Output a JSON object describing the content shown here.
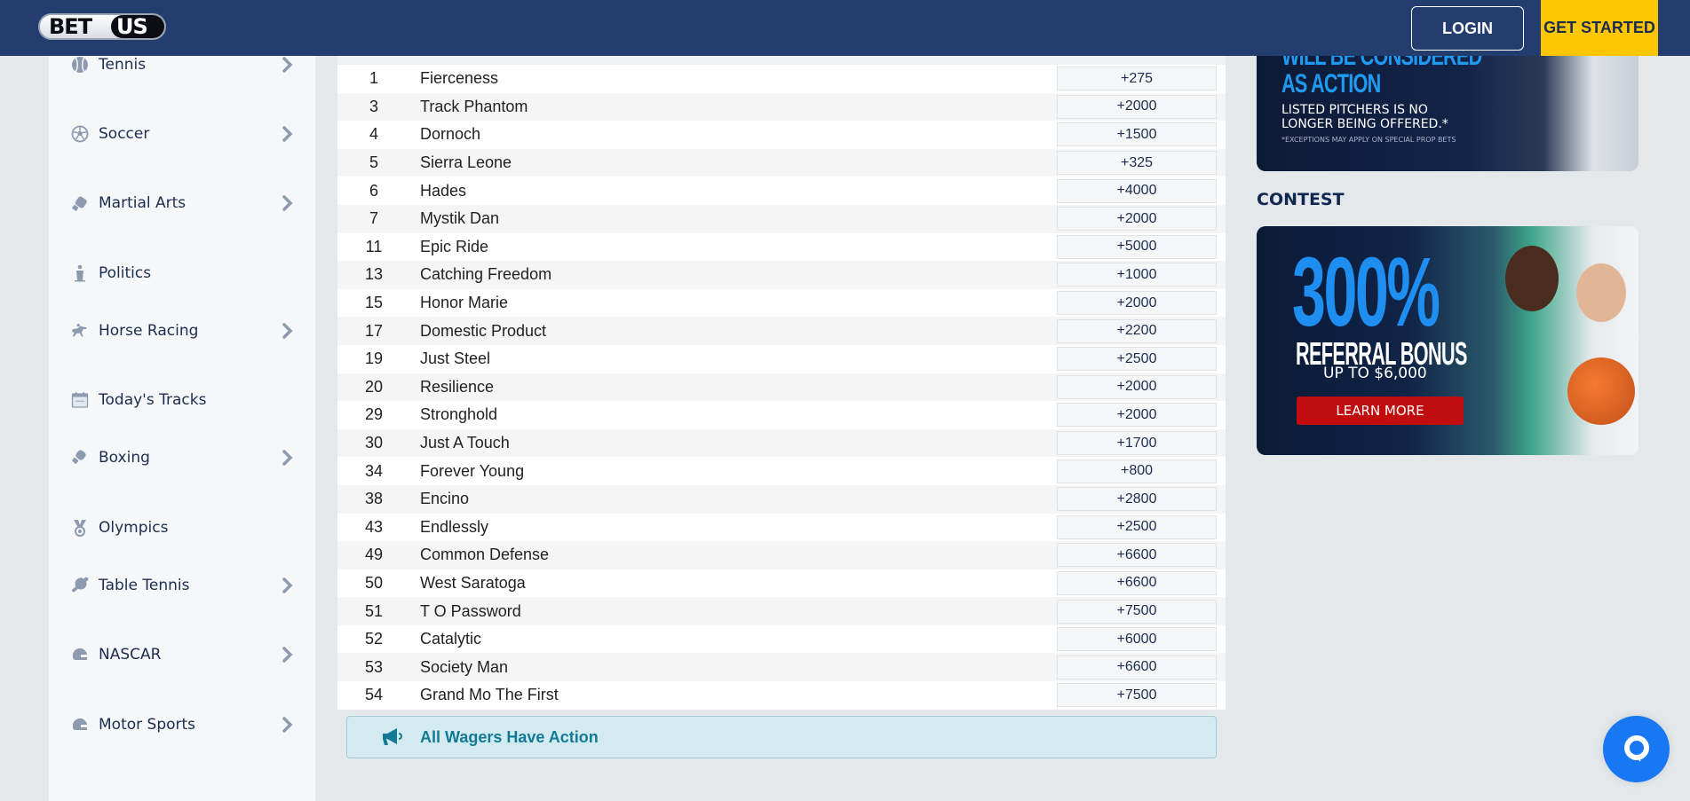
{
  "header": {
    "logo_left": "BET",
    "logo_right": "US",
    "login_label": "LOGIN",
    "get_started_label": "GET STARTED"
  },
  "sidebar": {
    "items": [
      {
        "label": "Tennis",
        "icon": "tennis-ball-icon",
        "has_chevron": true
      },
      {
        "label": "Soccer",
        "icon": "soccer-ball-icon",
        "has_chevron": true
      },
      {
        "label": "Martial Arts",
        "icon": "martial-arts-glove-icon",
        "has_chevron": true
      },
      {
        "label": "Politics",
        "icon": "podium-icon",
        "has_chevron": false
      },
      {
        "label": "Horse Racing",
        "icon": "horse-racing-icon",
        "has_chevron": true
      },
      {
        "label": "Today's Tracks",
        "icon": "calendar-today-icon",
        "has_chevron": false
      },
      {
        "label": "Boxing",
        "icon": "boxing-glove-icon",
        "has_chevron": true
      },
      {
        "label": "Olympics",
        "icon": "medal-icon",
        "has_chevron": false
      },
      {
        "label": "Table Tennis",
        "icon": "ping-pong-paddle-icon",
        "has_chevron": true
      },
      {
        "label": "NASCAR",
        "icon": "racing-helmet-icon",
        "has_chevron": true
      },
      {
        "label": "Motor Sports",
        "icon": "racing-helmet-icon",
        "has_chevron": true
      }
    ]
  },
  "table": {
    "rows": [
      {
        "num": "1",
        "name": "Fierceness",
        "odds": "+275"
      },
      {
        "num": "3",
        "name": "Track Phantom",
        "odds": "+2000"
      },
      {
        "num": "4",
        "name": "Dornoch",
        "odds": "+1500"
      },
      {
        "num": "5",
        "name": "Sierra Leone",
        "odds": "+325"
      },
      {
        "num": "6",
        "name": "Hades",
        "odds": "+4000"
      },
      {
        "num": "7",
        "name": "Mystik Dan",
        "odds": "+2000"
      },
      {
        "num": "11",
        "name": "Epic Ride",
        "odds": "+5000"
      },
      {
        "num": "13",
        "name": "Catching Freedom",
        "odds": "+1000"
      },
      {
        "num": "15",
        "name": "Honor Marie",
        "odds": "+2000"
      },
      {
        "num": "17",
        "name": "Domestic Product",
        "odds": "+2200"
      },
      {
        "num": "19",
        "name": "Just Steel",
        "odds": "+2500"
      },
      {
        "num": "20",
        "name": "Resilience",
        "odds": "+2000"
      },
      {
        "num": "29",
        "name": "Stronghold",
        "odds": "+2000"
      },
      {
        "num": "30",
        "name": "Just A Touch",
        "odds": "+1700"
      },
      {
        "num": "34",
        "name": "Forever Young",
        "odds": "+800"
      },
      {
        "num": "38",
        "name": "Encino",
        "odds": "+2800"
      },
      {
        "num": "43",
        "name": "Endlessly",
        "odds": "+2500"
      },
      {
        "num": "49",
        "name": "Common Defense",
        "odds": "+6600"
      },
      {
        "num": "50",
        "name": "West Saratoga",
        "odds": "+6600"
      },
      {
        "num": "51",
        "name": "T O Password",
        "odds": "+7500"
      },
      {
        "num": "52",
        "name": "Catalytic",
        "odds": "+6000"
      },
      {
        "num": "53",
        "name": "Society Man",
        "odds": "+6600"
      },
      {
        "num": "54",
        "name": "Grand Mo The First",
        "odds": "+7500"
      }
    ]
  },
  "alert": {
    "text": "All Wagers Have Action",
    "icon": "megaphone-icon"
  },
  "promos": {
    "banner1": {
      "headline_1": "WILL BE CONSIDERED",
      "headline_2": "AS ACTION",
      "subtext_1": "LISTED PITCHERS IS NO",
      "subtext_2": "LONGER BEING OFFERED.*",
      "disclaimer": "*EXCEPTIONS MAY APPLY ON SPECIAL PROP BETS"
    },
    "contest_title": "CONTEST",
    "banner2": {
      "big_text": "300%",
      "title": "REFERRAL BONUS",
      "subtitle": "UP TO $6,000",
      "cta": "LEARN MORE"
    }
  },
  "colors": {
    "header_bg": "#233d6e",
    "accent_yellow": "#fec600",
    "alert_text": "#137a96",
    "chat_blue": "#1877f2",
    "cta_red": "#c10d0d"
  }
}
